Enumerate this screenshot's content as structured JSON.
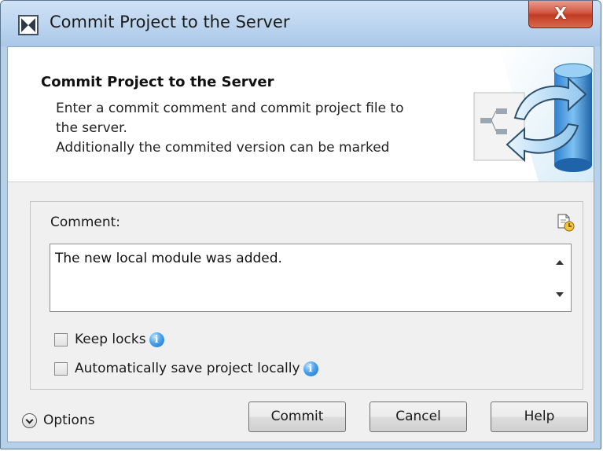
{
  "window": {
    "title": "Commit Project to the Server",
    "close_label": "X"
  },
  "header": {
    "title": "Commit Project to the Server",
    "description_lines": [
      "Enter a commit comment and commit project file to",
      "the server.",
      "Additionally the commited version can be marked"
    ]
  },
  "comment": {
    "label": "Comment:",
    "value": "The new local module was added."
  },
  "checkboxes": [
    {
      "label": "Keep locks",
      "checked": false
    },
    {
      "label": "Automatically save project locally",
      "checked": false
    }
  ],
  "footer": {
    "options_label": "Options",
    "commit_label": "Commit",
    "cancel_label": "Cancel",
    "help_label": "Help"
  },
  "colors": {
    "title_bar": "#bcd5ef",
    "close_button": "#c23b23",
    "info_icon": "#4aa3ee"
  }
}
